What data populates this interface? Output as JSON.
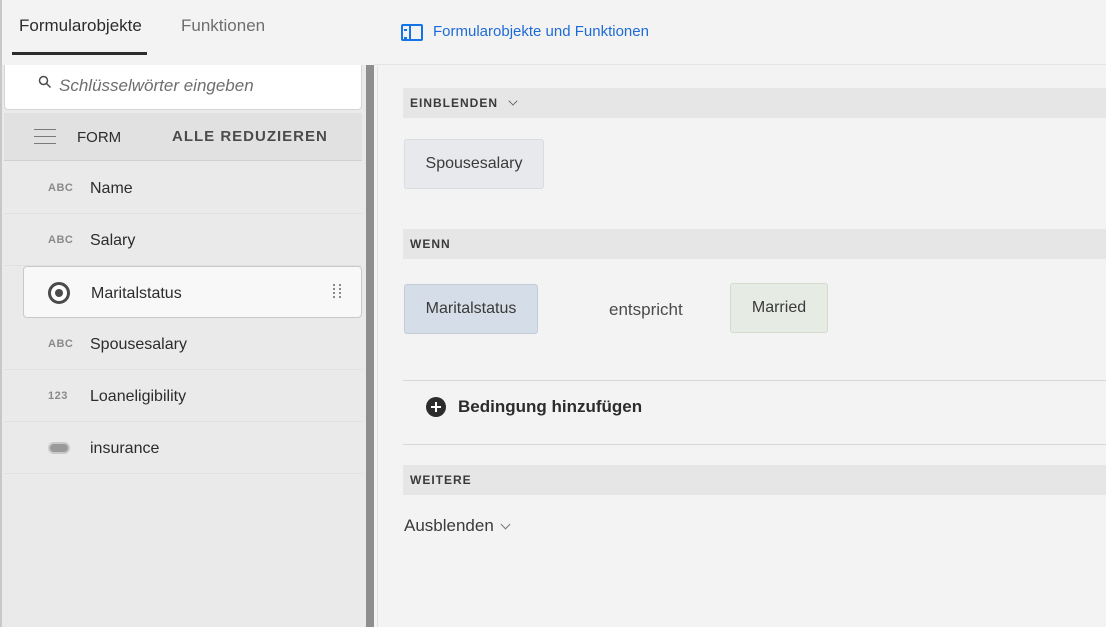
{
  "left_tabs": [
    {
      "label": "Formularobjekte"
    },
    {
      "label": "Funktionen"
    }
  ],
  "search": {
    "placeholder": "Schlüsselwörter eingeben",
    "icon": "search-icon"
  },
  "tree_header": {
    "form_label": "FORM",
    "collapse_all_label": "ALLE REDUZIEREN"
  },
  "tree_items": [
    {
      "type": "ABC",
      "label": "Name",
      "icon": "text-field-icon"
    },
    {
      "type": "ABC",
      "label": "Salary",
      "icon": "text-field-icon"
    },
    {
      "type": "",
      "label": "Maritalstatus",
      "icon": "radio-button-icon",
      "selected": true
    },
    {
      "type": "ABC",
      "label": "Spousesalary",
      "icon": "text-field-icon"
    },
    {
      "type": "123",
      "label": "Loaneligibility",
      "icon": "numeric-field-icon"
    },
    {
      "type": "",
      "label": "insurance",
      "icon": "toggle-icon"
    }
  ],
  "right_header": {
    "title": "Formularobjekte und Funktionen",
    "icon": "panel-icon",
    "accent_color": "#1473e6"
  },
  "rule": {
    "show_section": {
      "title": "EINBLENDEN",
      "target": "Spousesalary"
    },
    "when_section": {
      "title": "WENN",
      "field": "Maritalstatus",
      "operator": "entspricht",
      "value": "Married"
    },
    "add_condition_label": "Bedingung hinzufügen",
    "else_section": {
      "title": "WEITERE",
      "action": "Ausblenden"
    }
  }
}
